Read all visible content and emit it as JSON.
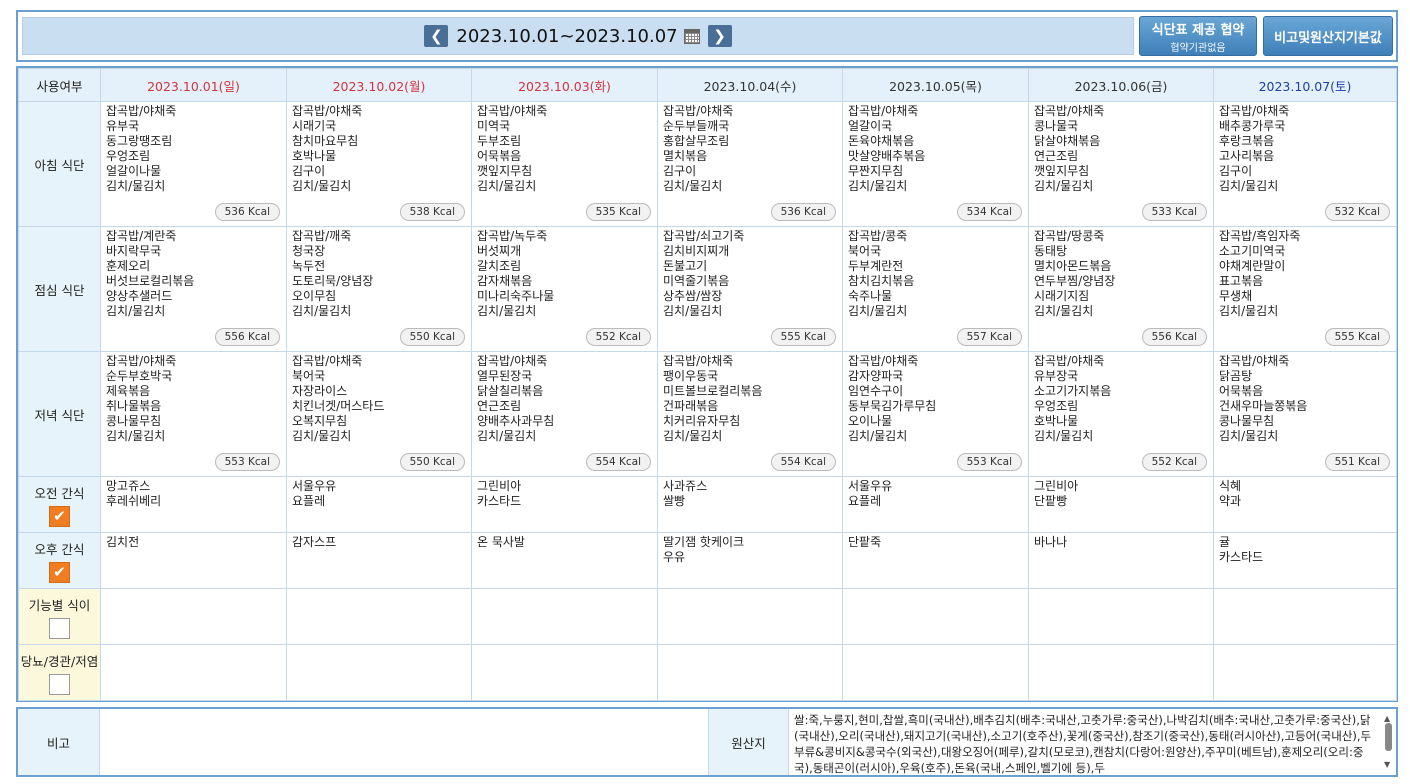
{
  "header": {
    "prev": "❮",
    "next": "❯",
    "range": "2023.10.01~2023.10.07",
    "btn_provide": "식단표 제공 협약",
    "btn_provide_sub": "협약기관없음",
    "btn_remarks": "비고및원산지기본값"
  },
  "grid": {
    "usage_label": "사용여부",
    "days": [
      {
        "label": "2023.10.01(일)",
        "color": "#d3343f"
      },
      {
        "label": "2023.10.02(월)",
        "color": "#d3343f"
      },
      {
        "label": "2023.10.03(화)",
        "color": "#d3343f"
      },
      {
        "label": "2023.10.04(수)",
        "color": "#333333"
      },
      {
        "label": "2023.10.05(목)",
        "color": "#333333"
      },
      {
        "label": "2023.10.06(금)",
        "color": "#333333"
      },
      {
        "label": "2023.10.07(토)",
        "color": "#1e3fa8"
      }
    ],
    "rows": {
      "breakfast": {
        "label": "아침 식단",
        "cells": [
          {
            "text": "잡곡밥/야채죽\n유부국\n동그랑땡조림\n우엉조림\n얼갈이나물\n김치/물김치",
            "kcal": "536 Kcal"
          },
          {
            "text": "잡곡밥/야채죽\n시래기국\n참치마요무침\n호박나물\n김구이\n김치/물김치",
            "kcal": "538 Kcal"
          },
          {
            "text": "잡곡밥/야채죽\n미역국\n두부조림\n어묵볶음\n깻잎지무침\n김치/물김치",
            "kcal": "535 Kcal"
          },
          {
            "text": "잡곡밥/야채죽\n순두부들깨국\n홍합살무조림\n멸치볶음\n김구이\n김치/물김치",
            "kcal": "536 Kcal"
          },
          {
            "text": "잡곡밥/야채죽\n얼갈이국\n돈육야채볶음\n맛살양배추볶음\n무짠지무침\n김치/물김치",
            "kcal": "534 Kcal"
          },
          {
            "text": "잡곡밥/야채죽\n콩나물국\n닭살야채볶음\n연근조림\n깻잎지무침\n김치/물김치",
            "kcal": "533 Kcal"
          },
          {
            "text": "잡곡밥/야채죽\n배추콩가루국\n후랑크볶음\n고사리볶음\n김구이\n김치/물김치",
            "kcal": "532 Kcal"
          }
        ]
      },
      "lunch": {
        "label": "점심 식단",
        "cells": [
          {
            "text": "잡곡밥/계란죽\n바지락무국\n훈제오리\n버섯브로컬리볶음\n양상추샐러드\n김치/물김치",
            "kcal": "556 Kcal"
          },
          {
            "text": "잡곡밥/깨죽\n청국장\n녹두전\n도토리묵/양념장\n오이무침\n김치/물김치",
            "kcal": "550 Kcal"
          },
          {
            "text": "잡곡밥/녹두죽\n버섯찌개\n갈치조림\n감자채볶음\n미나리숙주나물\n김치/물김치",
            "kcal": "552 Kcal"
          },
          {
            "text": "잡곡밥/쇠고기죽\n김치비지찌개\n돈불고기\n미역줄기볶음\n상추쌈/쌈장\n김치/물김치",
            "kcal": "555 Kcal"
          },
          {
            "text": "잡곡밥/콩죽\n북어국\n두부계란전\n참치김치볶음\n숙주나물\n김치/물김치",
            "kcal": "557 Kcal"
          },
          {
            "text": "잡곡밥/땅콩죽\n동태탕\n멸치아몬드볶음\n연두부찜/양념장\n시래기지짐\n김치/물김치",
            "kcal": "556 Kcal"
          },
          {
            "text": "잡곡밥/흑임자죽\n소고기미역국\n야채계란말이\n표고볶음\n무생채\n김치/물김치",
            "kcal": "555 Kcal"
          }
        ]
      },
      "dinner": {
        "label": "저녁 식단",
        "cells": [
          {
            "text": "잡곡밥/야채죽\n순두부호박국\n제육볶음\n취나물볶음\n콩나물무침\n김치/물김치",
            "kcal": "553 Kcal"
          },
          {
            "text": "잡곡밥/야채죽\n북어국\n자장라이스\n치킨너겟/머스타드\n오복지무침\n김치/물김치",
            "kcal": "550 Kcal"
          },
          {
            "text": "잡곡밥/야채죽\n열무된장국\n닭살칠리볶음\n연근조림\n양배추사과무침\n김치/물김치",
            "kcal": "554 Kcal"
          },
          {
            "text": "잡곡밥/야채죽\n팽이우동국\n미트볼브로컬리볶음\n건파래볶음\n치커리유자무침\n김치/물김치",
            "kcal": "554 Kcal"
          },
          {
            "text": "잡곡밥/야채죽\n감자양파국\n임연수구이\n동부묵김가루무침\n오이나물\n김치/물김치",
            "kcal": "553 Kcal"
          },
          {
            "text": "잡곡밥/야채죽\n유부장국\n소고기가지볶음\n우엉조림\n호박나물\n김치/물김치",
            "kcal": "552 Kcal"
          },
          {
            "text": "잡곡밥/야채죽\n닭곰탕\n어묵볶음\n건새우마늘쫑볶음\n콩나물무침\n김치/물김치",
            "kcal": "551 Kcal"
          }
        ]
      },
      "am_snack": {
        "label": "오전 간식",
        "checked": true,
        "cells": [
          "망고쥬스\n후레쉬베리",
          "서울우유\n요플레",
          "그린비아\n카스타드",
          "사과쥬스\n쌀빵",
          "서울우유\n요플레",
          "그린비아\n단팥빵",
          "식혜\n약과"
        ]
      },
      "pm_snack": {
        "label": "오후 간식",
        "checked": true,
        "cells": [
          "김치전",
          "감자스프",
          "온 묵사발",
          "딸기잼 핫케이크\n우유",
          "단팥죽",
          "바나나",
          "귤\n카스타드"
        ]
      },
      "functional": {
        "label": "기능별 식이",
        "checked": false,
        "cells": [
          "",
          "",
          "",
          "",
          "",
          "",
          ""
        ]
      },
      "diabetes": {
        "label": "당뇨/경관/저염",
        "checked": false,
        "cells": [
          "",
          "",
          "",
          "",
          "",
          "",
          ""
        ]
      }
    },
    "check_mark": "✔"
  },
  "footer": {
    "remarks_label": "비고",
    "origin_label": "원산지",
    "origin_text": "쌀:죽,누룽지,현미,찹쌀,흑미(국내산),배추김치(배추:국내산,고춧가루:중국산),나박김치(배추:국내산,고춧가루:중국산),닭(국내산),오리(국내산),돼지고기(국내산),소고기(호주산),꽃게(중국산),참조기(중국산),동태(러시아산),고등어(국내산),두부류&콩비지&콩국수(외국산),대왕오징어(페루),갈치(모로코),캔참치(다랑어:원양산),주꾸미(베트남),훈제오리(오리:중국),동태곤이(러시아),우육(호주),돈육(국내,스페인,벨기에 등),두",
    "scroll_up": "▲",
    "scroll_down": "▼"
  }
}
